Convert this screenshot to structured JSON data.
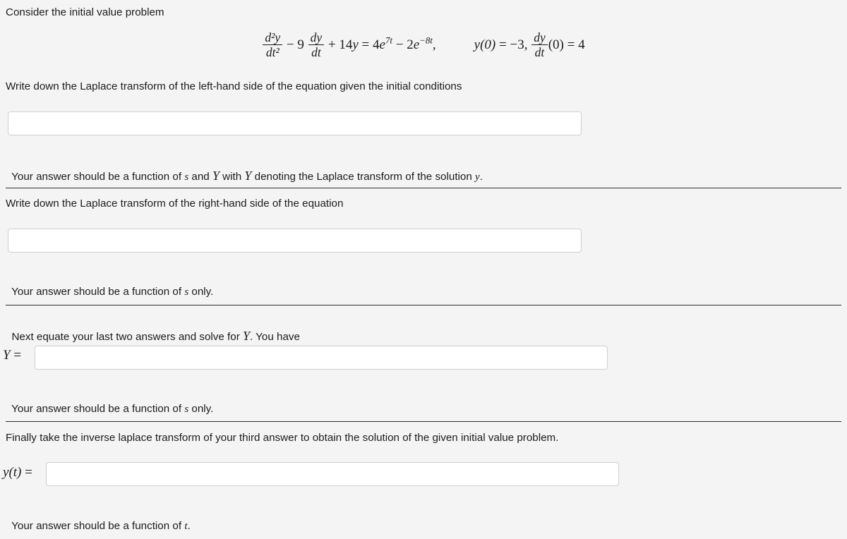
{
  "page": {
    "background_color": "#f4f4f4",
    "text_color": "#1c1c1c",
    "divider_color": "#2c2c2c",
    "input_border_color": "#cfcfcf",
    "input_background": "#ffffff"
  },
  "intro": {
    "text": "Consider the initial value problem"
  },
  "equation": {
    "lhs_second_derivative_num": "d²y",
    "lhs_second_derivative_den": "dt²",
    "minus": "−",
    "coefficient_first_derivative": "9",
    "first_derivative_num": "dy",
    "first_derivative_den": "dt",
    "plus": "+",
    "coefficient_y": "14",
    "y_symbol": "y",
    "equals": "=",
    "rhs_term1_coefficient": "4",
    "rhs_term1_base": "e",
    "rhs_term1_exponent": "7t",
    "rhs_term2_coefficient": "2",
    "rhs_term2_base": "e",
    "rhs_term2_exponent": "−8t",
    "comma": ",",
    "ic1_lhs": "y(0)",
    "ic1_equals": "=",
    "ic1_value": "−3",
    "ic1_comma": ",",
    "ic2_num": "dy",
    "ic2_den": "dt",
    "ic2_arg": "(0)",
    "ic2_equals": "=",
    "ic2_value": "4",
    "plain": "d²y/dt² − 9 dy/dt + 14y = 4e^(7t) − 2e^(−8t),   y(0) = −3,  dy/dt(0) = 4"
  },
  "sections": [
    {
      "prompt": "Write down the Laplace transform of the left-hand side of the equation given the initial conditions",
      "input_value": "",
      "input_placeholder": "",
      "hint_prefix": "Your answer should be a function of ",
      "hint_sym1": "s",
      "hint_mid1": " and ",
      "hint_sym2": "Y",
      "hint_mid2": " with ",
      "hint_sym3": "Y",
      "hint_suffix": " denoting the Laplace transform of the solution ",
      "hint_sym4": "y",
      "hint_end": ".",
      "label": ""
    },
    {
      "prompt": "Write down the Laplace transform of the right-hand side of the equation",
      "input_value": "",
      "input_placeholder": "",
      "hint_prefix": "Your answer should be a function of ",
      "hint_sym1": "s",
      "hint_suffix": " only.",
      "label": ""
    },
    {
      "prompt_prefix": "Next equate your last two answers and solve for ",
      "prompt_sym": "Y",
      "prompt_suffix": ". You have",
      "input_value": "",
      "input_placeholder": "",
      "hint_prefix": "Your answer should be a function of ",
      "hint_sym1": "s",
      "hint_suffix": " only.",
      "label_sym": "Y",
      "label_equals": "="
    },
    {
      "prompt": "Finally take the inverse laplace transform of your third answer to obtain the solution of the given initial value problem.",
      "input_value": "",
      "input_placeholder": "",
      "hint_prefix": "Your answer should be a function of ",
      "hint_sym1": "t",
      "hint_suffix": ".",
      "label_sym_y": "y",
      "label_sym_t": "(t)",
      "label_equals": "="
    }
  ]
}
